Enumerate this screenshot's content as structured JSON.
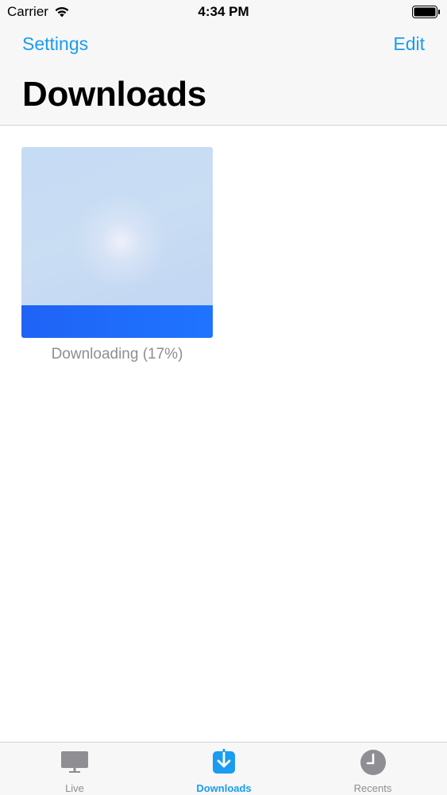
{
  "status_bar": {
    "carrier": "Carrier",
    "time": "4:34 PM"
  },
  "nav": {
    "left_button": "Settings",
    "right_button": "Edit",
    "title": "Downloads"
  },
  "download_item": {
    "status_text": "Downloading (17%)",
    "progress_percent": 17
  },
  "tabs": [
    {
      "label": "Live",
      "icon": "tv-icon",
      "selected": false
    },
    {
      "label": "Downloads",
      "icon": "download-icon",
      "selected": true
    },
    {
      "label": "Recents",
      "icon": "clock-icon",
      "selected": false
    }
  ],
  "colors": {
    "accent": "#1a9cf0",
    "progress_band": "#1f6cfa",
    "inactive": "#8e8e93"
  }
}
